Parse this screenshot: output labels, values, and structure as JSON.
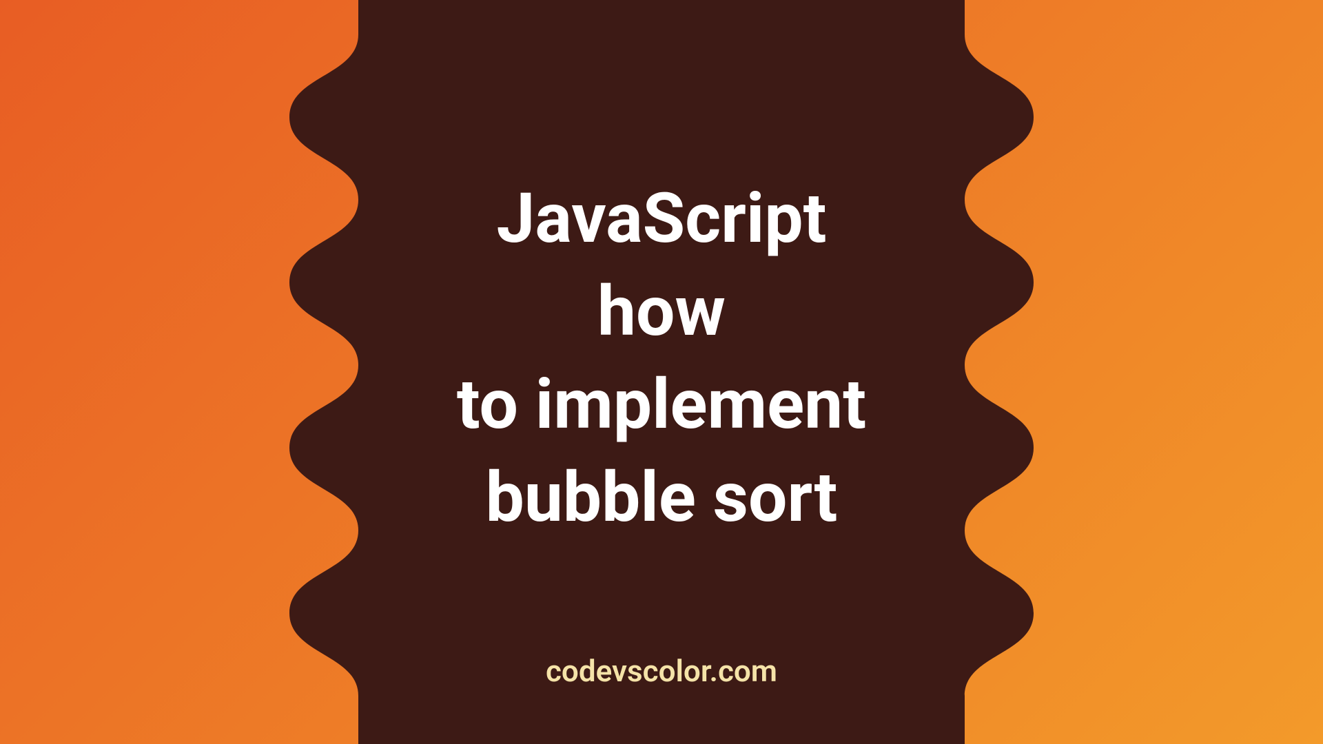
{
  "title_lines": [
    "JavaScript",
    "how",
    "to implement",
    "bubble sort"
  ],
  "credit": "codevscolor.com",
  "colors": {
    "blob_fill": "#3d1a15",
    "title_text": "#ffffff",
    "credit_text": "#f5e3a8",
    "bg_gradient_start": "#e85d24",
    "bg_gradient_end": "#f39a2a"
  }
}
